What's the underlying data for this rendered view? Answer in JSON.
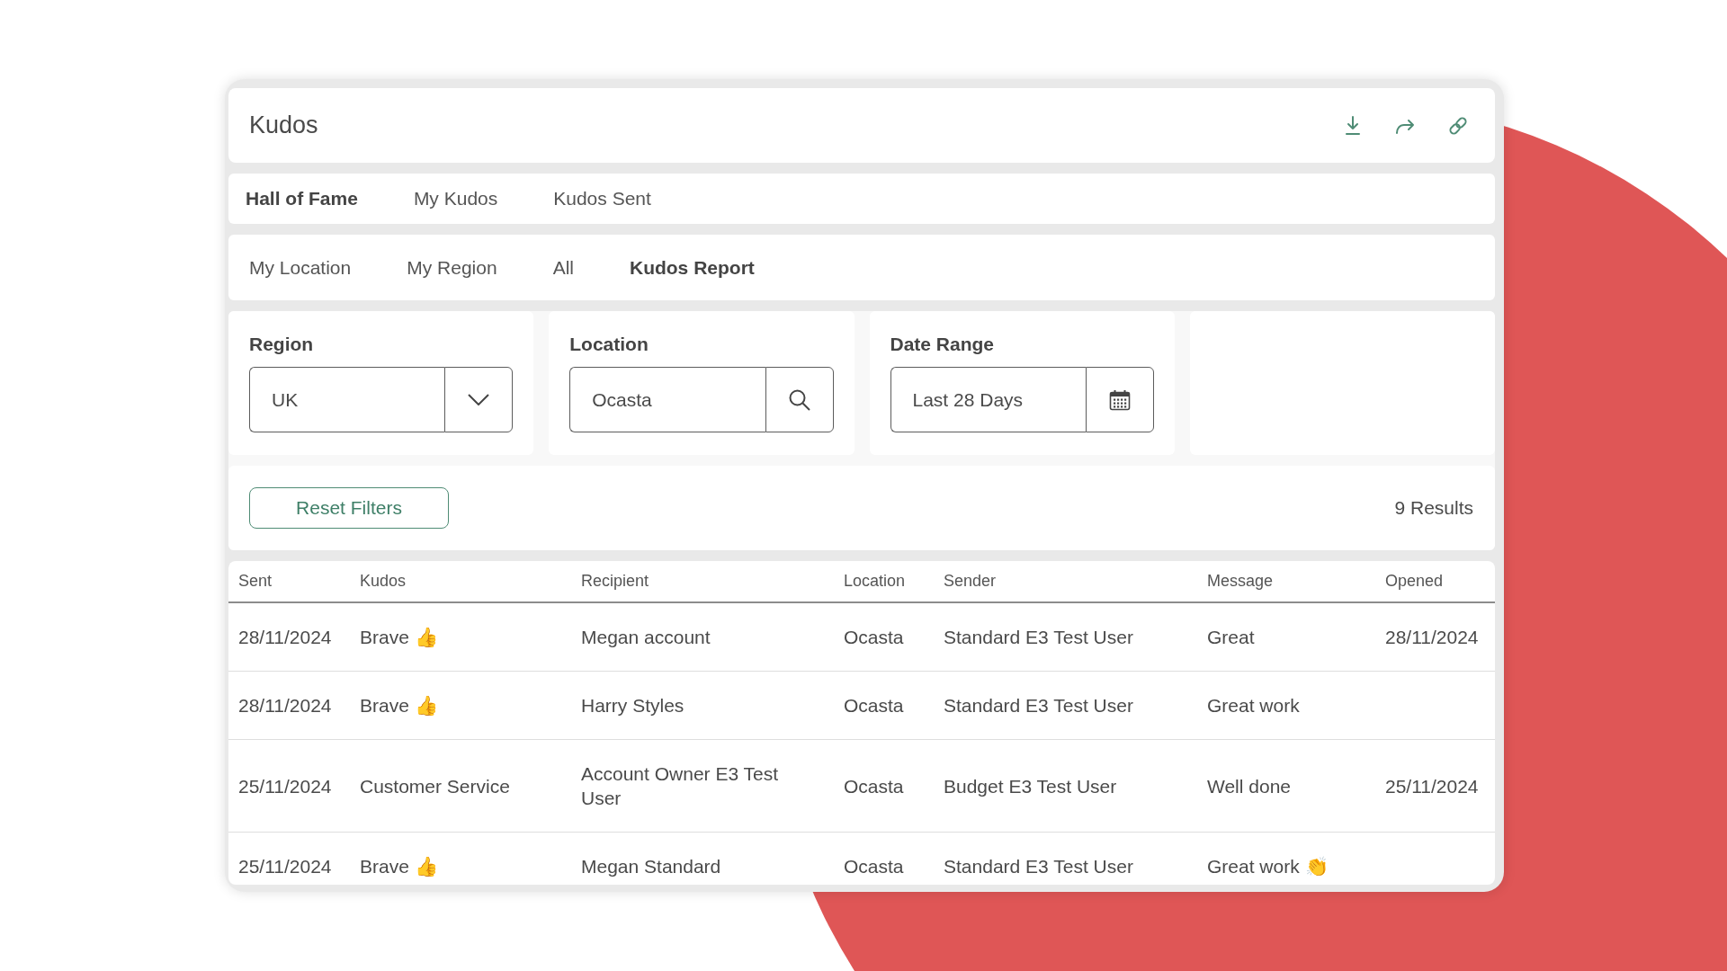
{
  "window": {
    "title": "Kudos"
  },
  "main_tabs": [
    {
      "label": "Hall of Fame",
      "selected": true
    },
    {
      "label": "My Kudos",
      "selected": false
    },
    {
      "label": "Kudos Sent",
      "selected": false
    }
  ],
  "sub_tabs": [
    {
      "label": "My Location",
      "selected": false
    },
    {
      "label": "My Region",
      "selected": false
    },
    {
      "label": "All",
      "selected": false
    },
    {
      "label": "Kudos Report",
      "selected": true
    }
  ],
  "filters": [
    {
      "kind": "dropdown",
      "label": "Region",
      "value": "UK"
    },
    {
      "kind": "search",
      "label": "Location",
      "value": "Ocasta"
    },
    {
      "kind": "date",
      "label": "Date Range",
      "value": "Last 28 Days"
    }
  ],
  "reset_button": "Reset Filters",
  "results_count": "9 Results",
  "table": {
    "columns": [
      "Sent",
      "Kudos",
      "Recipient",
      "Location",
      "Sender",
      "Message",
      "Opened"
    ],
    "rows": [
      [
        "28/11/2024",
        "Brave 👍",
        "Megan account",
        "Ocasta",
        "Standard E3 Test User",
        "Great",
        "28/11/2024"
      ],
      [
        "28/11/2024",
        "Brave 👍",
        "Harry Styles",
        "Ocasta",
        "Standard E3 Test User",
        "Great work",
        null
      ],
      [
        "25/11/2024",
        "Customer Service",
        "Account Owner E3 Test User",
        "Ocasta",
        "Budget E3 Test User",
        "Well done",
        "25/11/2024"
      ],
      [
        "25/11/2024",
        "Brave 👍",
        "Megan Standard",
        "Ocasta",
        "Standard E3 Test User",
        "Great work 👏",
        null
      ]
    ]
  }
}
